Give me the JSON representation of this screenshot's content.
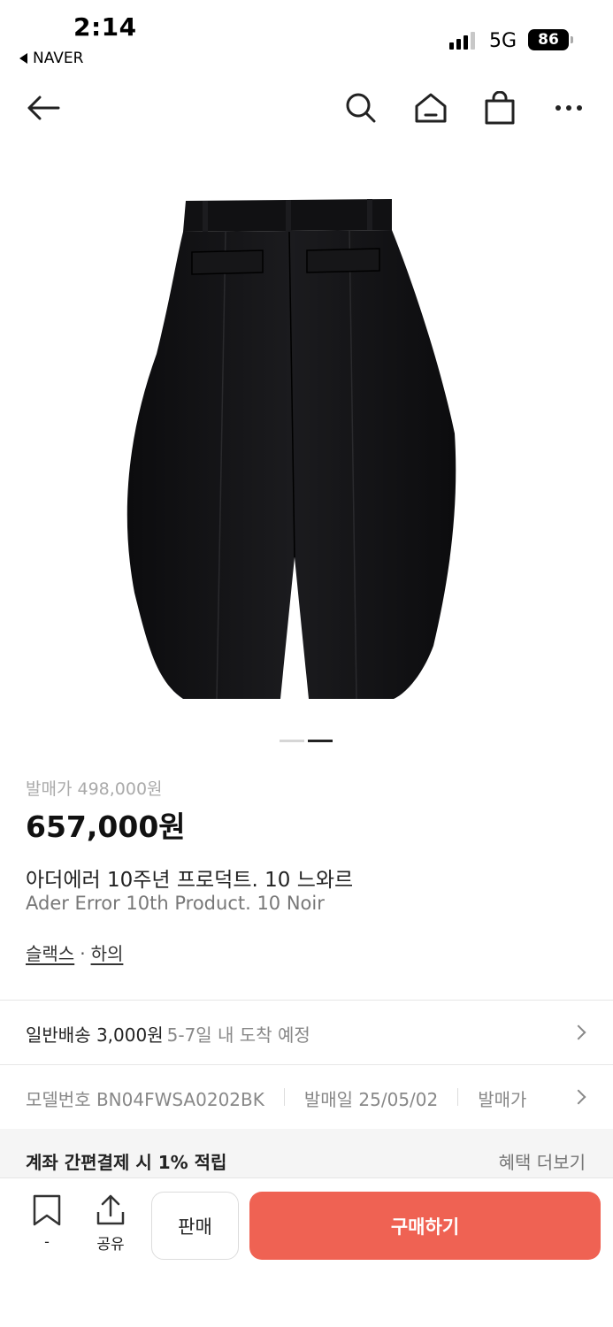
{
  "status_bar": {
    "time": "2:14",
    "back_app": "NAVER",
    "network": "5G",
    "battery": "86"
  },
  "nav": {
    "icons": [
      "back-arrow-icon",
      "search-icon",
      "home-icon",
      "shopping-bag-icon",
      "more-icon"
    ]
  },
  "carousel": {
    "slide_count": 2,
    "active_index": 1
  },
  "product": {
    "release_price": "발매가 498,000원",
    "price": "657,000원",
    "name_ko": "아더에러 10주년 프로덕트. 10 느와르",
    "name_en": "Ader Error 10th Product. 10 Noir",
    "categories": [
      "슬랙스",
      "하의"
    ],
    "category_separator": "·"
  },
  "shipping": {
    "main": "일반배송 3,000원",
    "sub": "5-7일 내 도착 예정"
  },
  "specs": [
    "모델번호 BN04FWSA0202BK",
    "발매일 25/05/02",
    "발매가"
  ],
  "benefit": {
    "left": "계좌 간편결제 시 1% 적립",
    "right": "혜택 더보기"
  },
  "bottom_bar": {
    "bookmark_count": "-",
    "share_label": "공유",
    "sell_label": "판매",
    "buy_label": "구매하기",
    "buy_color": "#ef6253"
  }
}
